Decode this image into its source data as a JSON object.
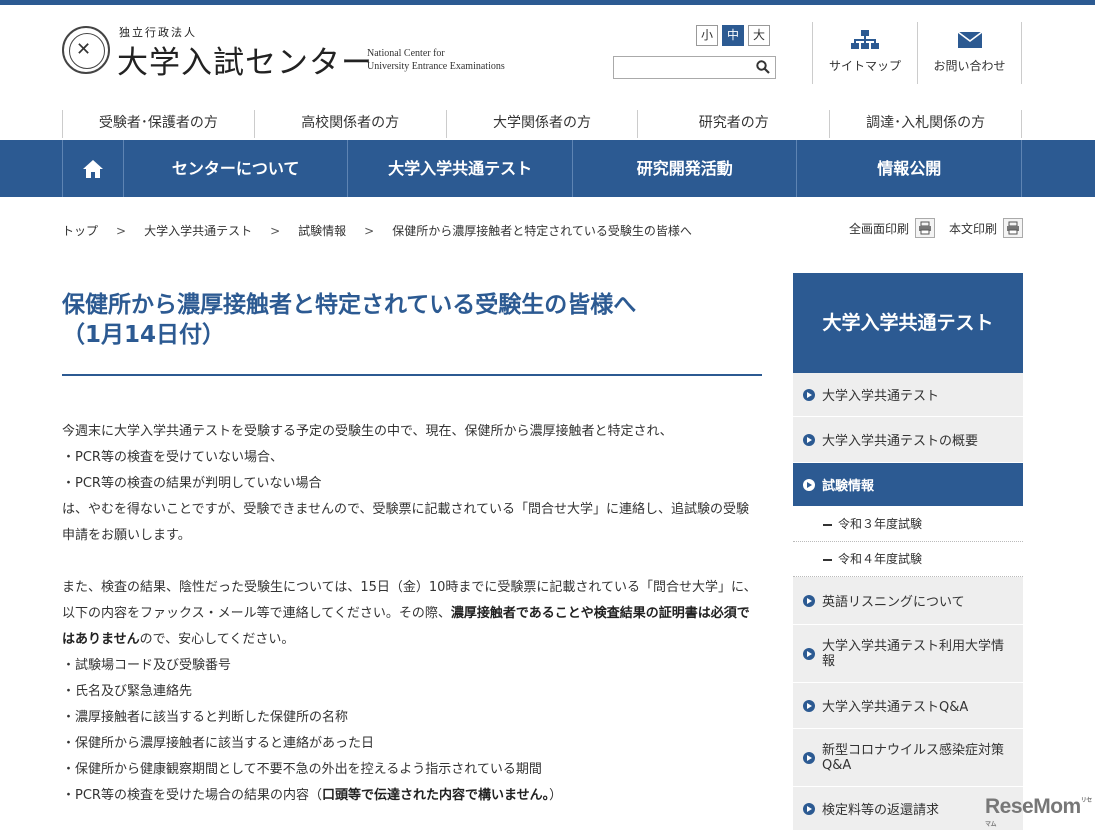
{
  "header": {
    "org_type": "独立行政法人",
    "org_name": "大学入試センター",
    "org_name_en_1": "National Center for",
    "org_name_en_2": "University Entrance Examinations",
    "font_sizes": [
      "小",
      "中",
      "大"
    ],
    "font_size_selected": "中",
    "search_value": "",
    "sitemap_label": "サイトマップ",
    "contact_label": "お問い合わせ"
  },
  "audience_nav": [
    "受験者･保護者の方",
    "高校関係者の方",
    "大学関係者の方",
    "研究者の方",
    "調達･入札関係の方"
  ],
  "main_nav": {
    "home_icon": "home-icon",
    "items": [
      "センターについて",
      "大学入学共通テスト",
      "研究開発活動",
      "情報公開"
    ]
  },
  "breadcrumb": [
    "トップ",
    "大学入学共通テスト",
    "試験情報",
    "保健所から濃厚接触者と特定されている受験生の皆様へ"
  ],
  "breadcrumb_separator": ">",
  "print": {
    "full": "全画面印刷",
    "body": "本文印刷"
  },
  "article": {
    "title_line1": "保健所から濃厚接触者と特定されている受験生の皆様へ",
    "title_line2": "（1月14日付）",
    "p1": "今週末に大学入学共通テストを受験する予定の受験生の中で、現在、保健所から濃厚接触者と特定され、",
    "p1_items": [
      "・PCR等の検査を受けていない場合、",
      "・PCR等の検査の結果が判明していない場合"
    ],
    "p1_end_1": "は、やむを得ないことですが、受験できませんので、受験票に記載されている「問合せ大学」に連絡し、追試験の受験",
    "p1_end_2": "申請をお願いします。",
    "p2_1": "また、検査の結果、陰性だった受験生については、15日（金）10時までに受験票に記載されている「問合せ大学」に、",
    "p2_2a": "以下の内容をファックス・メール等で連絡してください。その際、",
    "p2_2b": "濃厚接触者であることや検査結果の証明書は必須で",
    "p2_3a": "はありません",
    "p2_3b": "ので、安心してください。",
    "p2_items": [
      "・試験場コード及び受験番号",
      "・氏名及び緊急連絡先",
      "・濃厚接触者に該当すると判断した保健所の名称",
      "・保健所から濃厚接触者に該当すると連絡があった日",
      "・保健所から健康観察期間として不要不急の外出を控えるよう指示されている期間"
    ],
    "p2_last_a": "・PCR等の検査を受けた場合の結果の内容（",
    "p2_last_b": "口頭等で伝達された内容で構いません。",
    "p2_last_c": "）"
  },
  "sidebar": {
    "title": "大学入学共通テスト",
    "items": [
      "大学入学共通テスト",
      "大学入学共通テストの概要",
      "試験情報",
      "英語リスニングについて",
      "大学入学共通テスト利用大学情報",
      "大学入学共通テストQ&A",
      "新型コロナウイルス感染症対策Q&A",
      "検定料等の返還請求"
    ],
    "active_item": "試験情報",
    "subitems": [
      "令和３年度試験",
      "令和４年度試験"
    ]
  },
  "watermark": {
    "text": "ReseMom",
    "small": "リセマム"
  },
  "colors": {
    "brand": "#2c5a92",
    "sidebar_bg": "#eeeeee"
  }
}
